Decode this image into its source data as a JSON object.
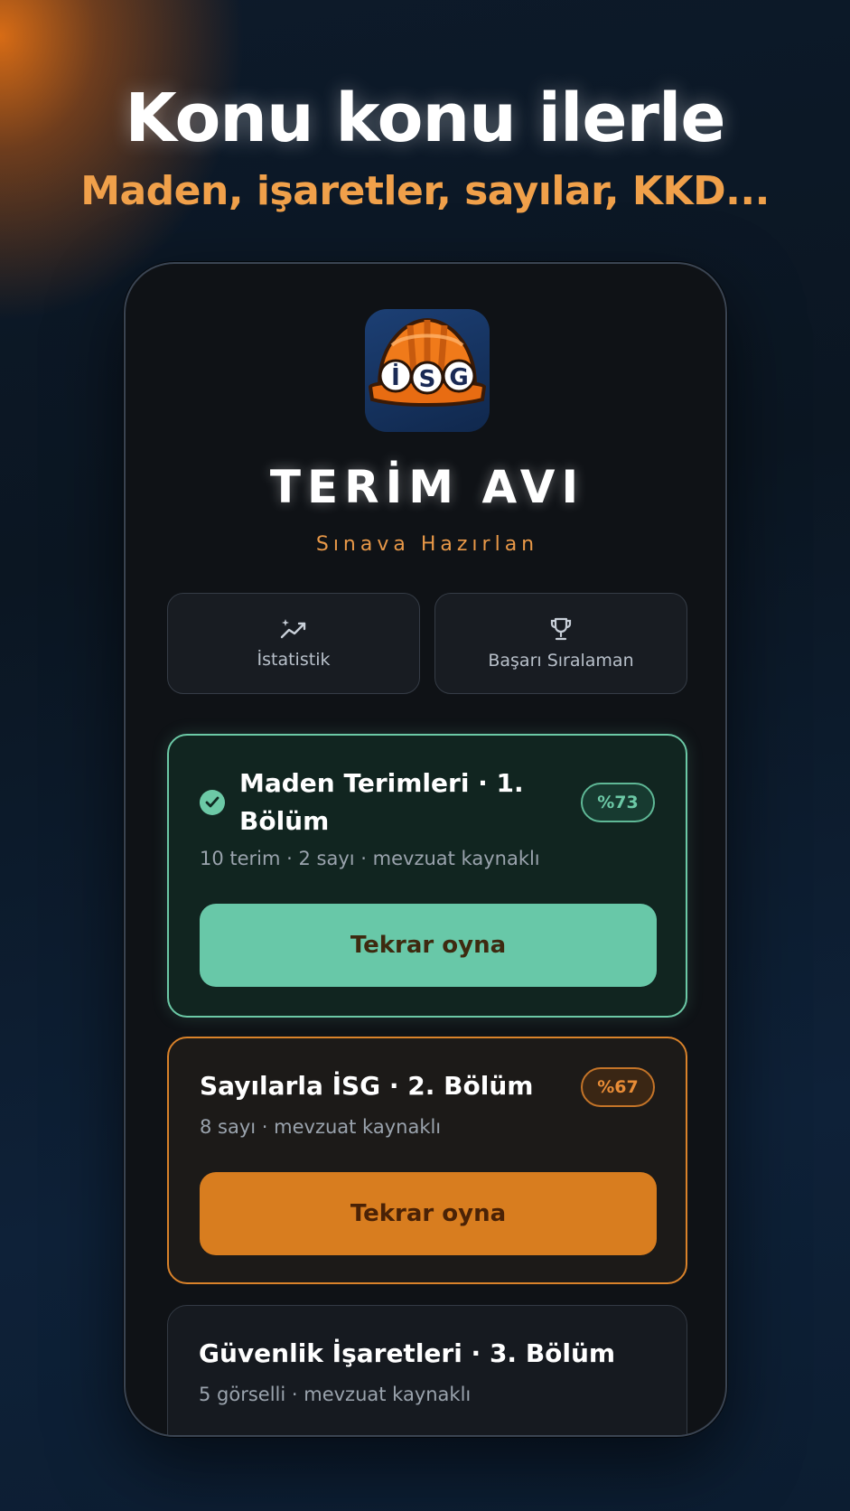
{
  "headline": "Konu konu ilerle",
  "subheadline": "Maden, işaretler, sayılar, KKD...",
  "app": {
    "icon_text": "İSG",
    "title": "TERİM AVI",
    "subtitle": "Sınava Hazırlan"
  },
  "nav": {
    "stats_label": "İstatistik",
    "ranking_label": "Başarı Sıralaman"
  },
  "levels": [
    {
      "title_line1": "Maden Terimleri · 1.",
      "title_line2": "Bölüm",
      "meta": "10 terim · 2 sayı · mevzuat kaynaklı",
      "score": "%73",
      "action": "Tekrar oyna",
      "status": "completed",
      "accent": "#6cc9a6"
    },
    {
      "title": "Sayılarla İSG · 2. Bölüm",
      "meta": "8 sayı · mevzuat kaynaklı",
      "score": "%67",
      "action": "Tekrar oyna",
      "accent": "#d87d1f"
    },
    {
      "title": "Güvenlik İşaretleri · 3. Bölüm",
      "meta": "5 görselli · mevzuat kaynaklı"
    }
  ],
  "colors": {
    "green_accent": "#6cc9a6",
    "orange_accent": "#d87d1f",
    "subtitle_orange": "#f0a04a"
  },
  "icons": {
    "stats": "chart-sparkle-icon",
    "ranking": "trophy-icon",
    "completed": "check-circle-icon",
    "app": "hard-hat-icon"
  }
}
